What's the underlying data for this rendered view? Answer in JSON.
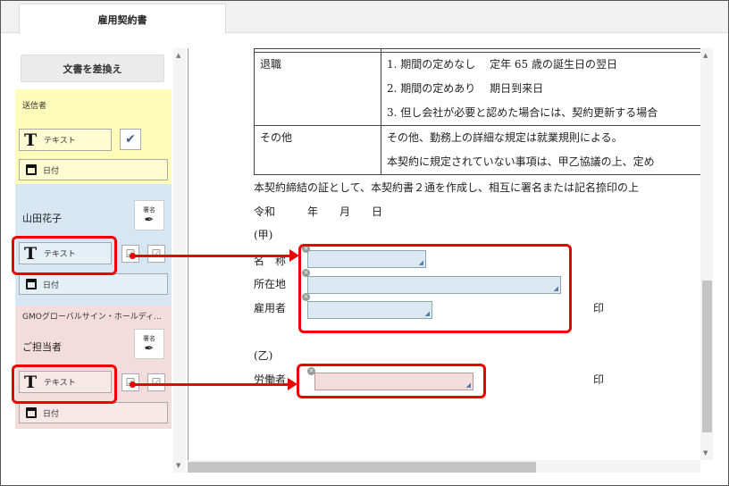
{
  "tab": {
    "title": "雇用契約書"
  },
  "sidebar": {
    "replace_button": "文書を差換え",
    "sender": {
      "title": "送信者",
      "text_field": "テキスト",
      "date_field": "日付"
    },
    "signer1": {
      "name": "山田花子",
      "sign_label": "署名",
      "text_field": "テキスト",
      "date_field": "日付"
    },
    "signer2": {
      "company": "GMOグローバルサイン・ホールディ...",
      "name": "ご担当者",
      "sign_label": "署名",
      "text_field": "テキスト",
      "date_field": "日付"
    }
  },
  "document": {
    "rows": [
      {
        "key": "",
        "lines": [
          ""
        ]
      },
      {
        "key": "退職",
        "lines": [
          "1. 期間の定めなし　 定年 65 歳の誕生日の翌日",
          "2. 期間の定めあり　 期日到来日",
          "3. 但し会社が必要と認めた場合には、契約更新する場合"
        ]
      },
      {
        "key": "その他",
        "lines": [
          "その他、勤務上の詳細な規定は就業規則による。",
          "本契約に規定されていない事項は、甲乙協議の上、定め"
        ]
      }
    ],
    "para": "本契約締結の証として、本契約書２通を作成し、相互に署名または記名捺印の上",
    "date_line": "令和　　　年　　月　　日",
    "party_a": "(甲)",
    "name_label": "名　称",
    "address_label": "所在地",
    "employer_label": "雇用者",
    "seal": "印",
    "party_b": "(乙)",
    "worker_label": "労働者",
    "seal2": "印"
  },
  "colors": {
    "sender": "#fffbb9",
    "signer1": "#d6e6f2",
    "signer2": "#f3dcdc",
    "highlight": "#ee0000"
  }
}
